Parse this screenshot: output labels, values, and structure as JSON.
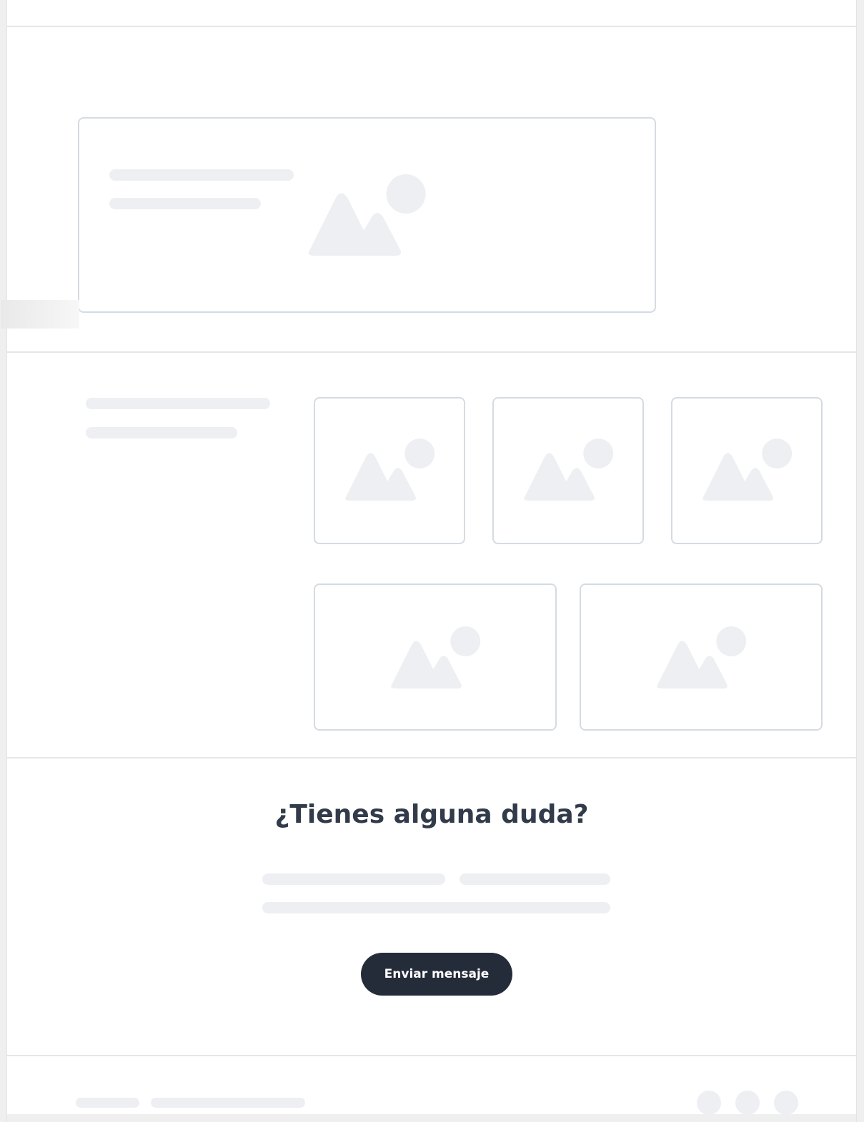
{
  "contact": {
    "heading": "¿Tienes alguna duda?",
    "button_label": "Enviar mensaje"
  },
  "colors": {
    "button_background": "#252c39",
    "button_text": "#ffffff",
    "heading_text": "#323b4a",
    "placeholder_fill": "#edeff3",
    "card_border": "#d5dbe2",
    "divider": "#e3e6ea"
  },
  "icons": {
    "image_placeholder": "image-placeholder-icon",
    "social": [
      "social-icon-1",
      "social-icon-2",
      "social-icon-3"
    ]
  }
}
